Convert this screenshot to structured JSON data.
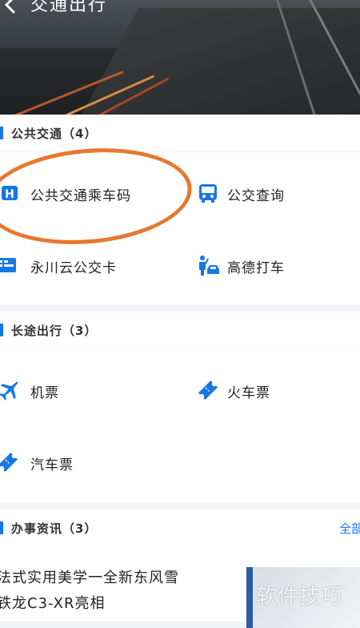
{
  "header": {
    "title": "交通出行"
  },
  "sections": {
    "public": {
      "title": "公共交通（4）",
      "items": [
        {
          "label": "公共交通乘车码",
          "icon": "h-badge-icon"
        },
        {
          "label": "公交查询",
          "icon": "bus-icon"
        },
        {
          "label": "永川云公交卡",
          "icon": "transit-card-icon"
        },
        {
          "label": "高德打车",
          "icon": "taxi-hail-icon"
        }
      ]
    },
    "longdist": {
      "title": "长途出行（3）",
      "items": [
        {
          "label": "机票",
          "icon": "airplane-icon"
        },
        {
          "label": "火车票",
          "icon": "train-ticket-icon"
        },
        {
          "label": "汽车票",
          "icon": "bus-ticket-icon"
        }
      ]
    },
    "news": {
      "title": "办事资讯（3）",
      "more": "全部",
      "headline_line1": "法式实用美学一全新东风雪",
      "headline_line2": "铁龙C3-XR亮相"
    }
  },
  "watermark": "软件技巧",
  "colors": {
    "accent": "#1677e6",
    "annotation": "#e8772e"
  }
}
